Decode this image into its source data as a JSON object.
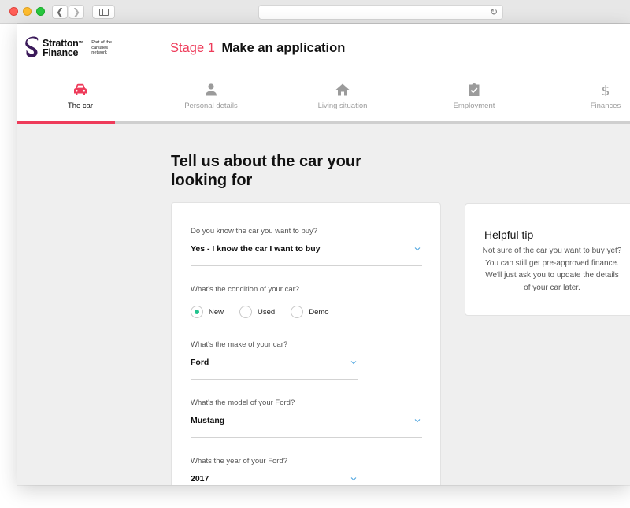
{
  "brand": {
    "name_line1": "Stratton",
    "name_line2": "Finance",
    "trademark": "™",
    "network_line1": "Part of the",
    "network_line2": "carsales",
    "network_line3": "network",
    "accent_color": "#ee3b5a",
    "logo_color": "#3b1a5a"
  },
  "header": {
    "stage_number": "Stage 1",
    "stage_title": "Make an application"
  },
  "steps": [
    {
      "label": "The car",
      "icon": "car-icon",
      "active": true
    },
    {
      "label": "Personal details",
      "icon": "person-icon",
      "active": false
    },
    {
      "label": "Living situation",
      "icon": "home-icon",
      "active": false
    },
    {
      "label": "Employment",
      "icon": "clipboard-check-icon",
      "active": false
    },
    {
      "label": "Finances",
      "icon": "dollar-icon",
      "active": false
    }
  ],
  "progress": {
    "fraction": 0.2
  },
  "main": {
    "heading": "Tell us about the car your looking for",
    "know_car": {
      "label": "Do you know the car you want to buy?",
      "value": "Yes - I know the car I want to buy"
    },
    "condition": {
      "label": "What's the condition of your car?",
      "options": [
        "New",
        "Used",
        "Demo"
      ],
      "selected": "New"
    },
    "make": {
      "label": "What's the make of your car?",
      "value": "Ford"
    },
    "model": {
      "label": "What's the model of your Ford?",
      "value": "Mustang"
    },
    "year": {
      "label": "Whats the year of your Ford?",
      "value": "2017"
    }
  },
  "tip": {
    "title": "Helpful tip",
    "body": "Not sure of the car you want to buy yet? You can still get pre-approved finance. We'll just ask you to update the details of your car later."
  },
  "colors": {
    "radio_checked": "#22c38e",
    "chevron": "#4aa3df"
  }
}
